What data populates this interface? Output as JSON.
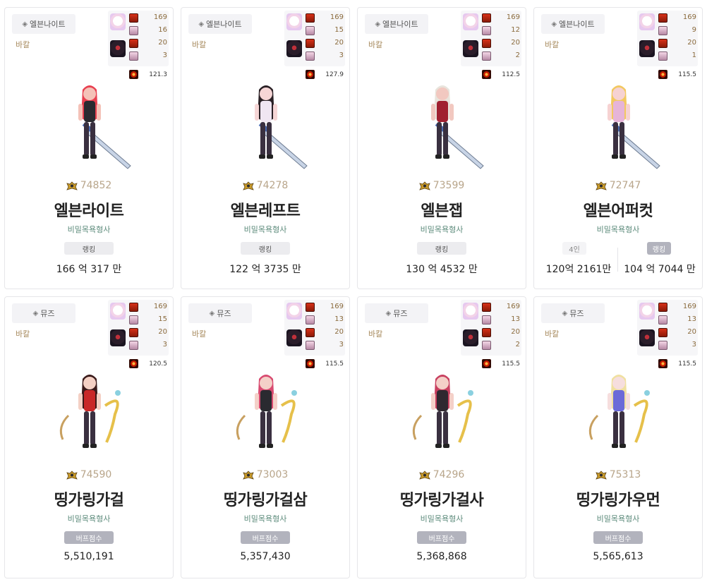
{
  "colors": {
    "server": "#a6895c",
    "guild": "#5b8a7a",
    "score": "#b8a58a",
    "tag_dark": "#b2b3bd"
  },
  "cards": [
    {
      "job": "엘븐나이트",
      "job_icon": "shield-icon",
      "server": "바칼",
      "stats": [
        "169",
        "16",
        "20",
        "3"
      ],
      "extra": "121.3",
      "score": "74852",
      "name": "엘븐라이트",
      "guild": "비밀목욕형사",
      "tags": [
        {
          "label": "랭킹",
          "style": "light"
        }
      ],
      "values": [
        "166 억 317 만"
      ],
      "skin": "#f4c2b8",
      "hair": "#e84050",
      "outfit": "#2a2a30",
      "weapon": "lance"
    },
    {
      "job": "엘븐나이트",
      "job_icon": "shield-icon",
      "server": "바칼",
      "stats": [
        "169",
        "15",
        "20",
        "3"
      ],
      "extra": "127.9",
      "score": "74278",
      "name": "엘븐레프트",
      "guild": "비밀목욕형사",
      "tags": [
        {
          "label": "랭킹",
          "style": "light"
        }
      ],
      "values": [
        "122 억 3735 만"
      ],
      "skin": "#f6d6d6",
      "hair": "#2a2025",
      "outfit": "#f0e6f2",
      "weapon": "lance"
    },
    {
      "job": "엘븐나이트",
      "job_icon": "shield-icon",
      "server": "바칼",
      "stats": [
        "169",
        "12",
        "20",
        "2"
      ],
      "extra": "112.5",
      "score": "73599",
      "name": "엘븐잽",
      "guild": "비밀목욕형사",
      "tags": [
        {
          "label": "랭킹",
          "style": "light"
        }
      ],
      "values": [
        "130 억 4532 만"
      ],
      "skin": "#f2c8c0",
      "hair": "#e8e4dc",
      "outfit": "#a02030",
      "weapon": "lance"
    },
    {
      "job": "엘븐나이트",
      "job_icon": "shield-icon",
      "server": "바칼",
      "stats": [
        "169",
        "9",
        "20",
        "1"
      ],
      "extra": "115.5",
      "score": "72747",
      "name": "엘븐어퍼컷",
      "guild": "비밀목욕형사",
      "tags": [
        {
          "label": "4인",
          "style": "white"
        },
        {
          "label": "랭킹",
          "style": "dark"
        }
      ],
      "values": [
        "120억 2161만",
        "104 억 7044 만"
      ],
      "skin": "#f6d2d2",
      "hair": "#f2c860",
      "outfit": "#e6b4d8",
      "weapon": "lance"
    },
    {
      "job": "뮤즈",
      "job_icon": "shield-icon",
      "server": "바칼",
      "stats": [
        "169",
        "15",
        "20",
        "3"
      ],
      "extra": "120.5",
      "score": "74590",
      "name": "띵가링가걸",
      "guild": "비밀목욕형사",
      "tags": [
        {
          "label": "버프점수",
          "style": "dark"
        }
      ],
      "values": [
        "5,510,191"
      ],
      "skin": "#f4d0c4",
      "hair": "#3a1a1a",
      "outfit": "#c82828",
      "weapon": "harp"
    },
    {
      "job": "뮤즈",
      "job_icon": "shield-icon",
      "server": "바칼",
      "stats": [
        "169",
        "13",
        "20",
        "3"
      ],
      "extra": "115.5",
      "score": "73003",
      "name": "띵가링가걸삼",
      "guild": "비밀목욕형사",
      "tags": [
        {
          "label": "버프점수",
          "style": "dark"
        }
      ],
      "values": [
        "5,357,430"
      ],
      "skin": "#f4d0c8",
      "hair": "#d84a70",
      "outfit": "#2a2a30",
      "weapon": "harp"
    },
    {
      "job": "뮤즈",
      "job_icon": "shield-icon",
      "server": "바칼",
      "stats": [
        "169",
        "13",
        "20",
        "2"
      ],
      "extra": "115.5",
      "score": "74296",
      "name": "띵가링가걸사",
      "guild": "비밀목욕형사",
      "tags": [
        {
          "label": "버프점수",
          "style": "dark"
        }
      ],
      "values": [
        "5,368,868"
      ],
      "skin": "#f4d0c8",
      "hair": "#c84060",
      "outfit": "#302830",
      "weapon": "harp"
    },
    {
      "job": "뮤즈",
      "job_icon": "shield-icon",
      "server": "바칼",
      "stats": [
        "169",
        "13",
        "20",
        "3"
      ],
      "extra": "115.5",
      "score": "75313",
      "name": "띵가링가우먼",
      "guild": "비밀목욕형사",
      "tags": [
        {
          "label": "버프점수",
          "style": "dark"
        }
      ],
      "values": [
        "5,565,613"
      ],
      "skin": "#f6dede",
      "hair": "#f0e0a0",
      "outfit": "#6c6ad8",
      "weapon": "harp"
    }
  ]
}
